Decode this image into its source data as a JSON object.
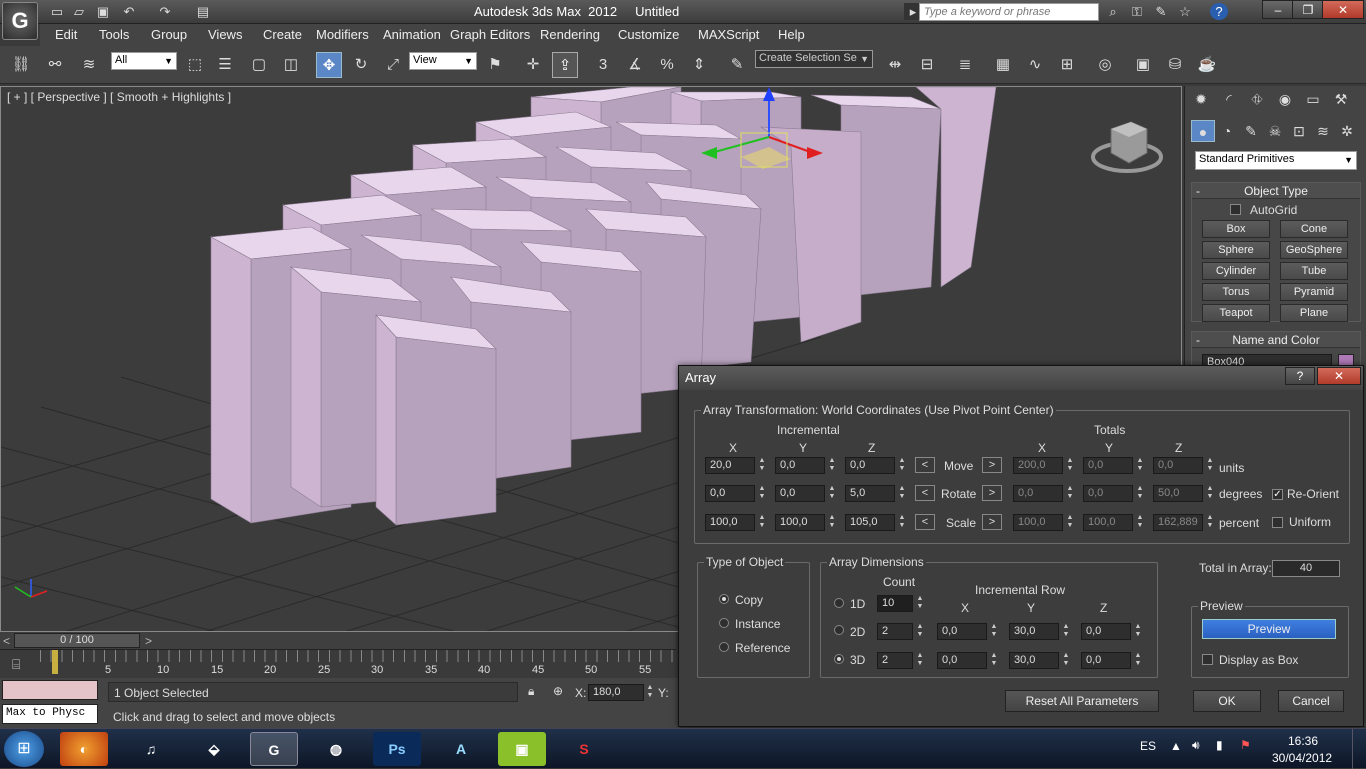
{
  "titlebar": {
    "title": "Autodesk 3ds Max  2012     Untitled",
    "search_placeholder": "Type a keyword or phrase",
    "logo": "app-logo-icon"
  },
  "menu": [
    "Edit",
    "Tools",
    "Group",
    "Views",
    "Create",
    "Modifiers",
    "Animation",
    "Graph Editors",
    "Rendering",
    "Customize",
    "MAXScript",
    "Help"
  ],
  "toolbar": {
    "filter": "All",
    "ref_coord": "View",
    "selection_set": "Create Selection Se",
    "snap_label": "3"
  },
  "viewport": {
    "label": "[ + ] [ Perspective ] [ Smooth + Highlights ]"
  },
  "command_panel": {
    "dropdown": "Standard Primitives",
    "object_type": {
      "title": "Object Type",
      "autogrid": "AutoGrid",
      "buttons": [
        "Box",
        "Cone",
        "Sphere",
        "GeoSphere",
        "Cylinder",
        "Tube",
        "Torus",
        "Pyramid",
        "Teapot",
        "Plane"
      ]
    },
    "name_color": {
      "title": "Name and Color",
      "name_value": "Box040",
      "swatch_color": "#b07ab8"
    }
  },
  "timeslider": {
    "position": "0 / 100",
    "prev": "<",
    "next": ">"
  },
  "ruler": {
    "ticks": [
      "5",
      "10",
      "15",
      "20",
      "25",
      "30",
      "35",
      "40",
      "45",
      "50",
      "55"
    ]
  },
  "status": {
    "script_listener": "Max to Physc",
    "selected": "1 Object Selected",
    "prompt": "Click and drag to select and move objects",
    "x_label": "X:",
    "x_value": "180,0",
    "y_label": "Y:"
  },
  "dialog": {
    "title": "Array",
    "help": "?",
    "close": "✕",
    "transform_title": "Array Transformation: World Coordinates (Use Pivot Point Center)",
    "incremental": "Incremental",
    "totals": "Totals",
    "axis": [
      "X",
      "Y",
      "Z"
    ],
    "rows": [
      {
        "label": "Move",
        "inc": [
          "20,0",
          "0,0",
          "0,0"
        ],
        "tot": [
          "200,0",
          "0,0",
          "0,0"
        ],
        "unit": "units"
      },
      {
        "label": "Rotate",
        "inc": [
          "0,0",
          "0,0",
          "5,0"
        ],
        "tot": [
          "0,0",
          "0,0",
          "50,0"
        ],
        "unit": "degrees"
      },
      {
        "label": "Scale",
        "inc": [
          "100,0",
          "100,0",
          "105,0"
        ],
        "tot": [
          "100,0",
          "100,0",
          "162,889"
        ],
        "unit": "percent"
      }
    ],
    "left_arrow": "<",
    "right_arrow": ">",
    "reorient": "Re-Orient",
    "uniform": "Uniform",
    "type_title": "Type of Object",
    "types": [
      "Copy",
      "Instance",
      "Reference"
    ],
    "dims_title": "Array Dimensions",
    "count": "Count",
    "incremental_row": "Incremental Row",
    "dims": [
      {
        "label": "1D",
        "count": "10"
      },
      {
        "label": "2D",
        "count": "2",
        "x": "0,0",
        "y": "30,0",
        "z": "0,0"
      },
      {
        "label": "3D",
        "count": "2",
        "x": "0,0",
        "y": "30,0",
        "z": "0,0"
      }
    ],
    "total_label": "Total in Array:",
    "total_value": "40",
    "preview_title": "Preview",
    "preview_btn": "Preview",
    "display_box": "Display as Box",
    "reset": "Reset All Parameters",
    "ok": "OK",
    "cancel": "Cancel"
  },
  "taskbar": {
    "lang": "ES",
    "time": "16:36",
    "date": "30/04/2012"
  }
}
